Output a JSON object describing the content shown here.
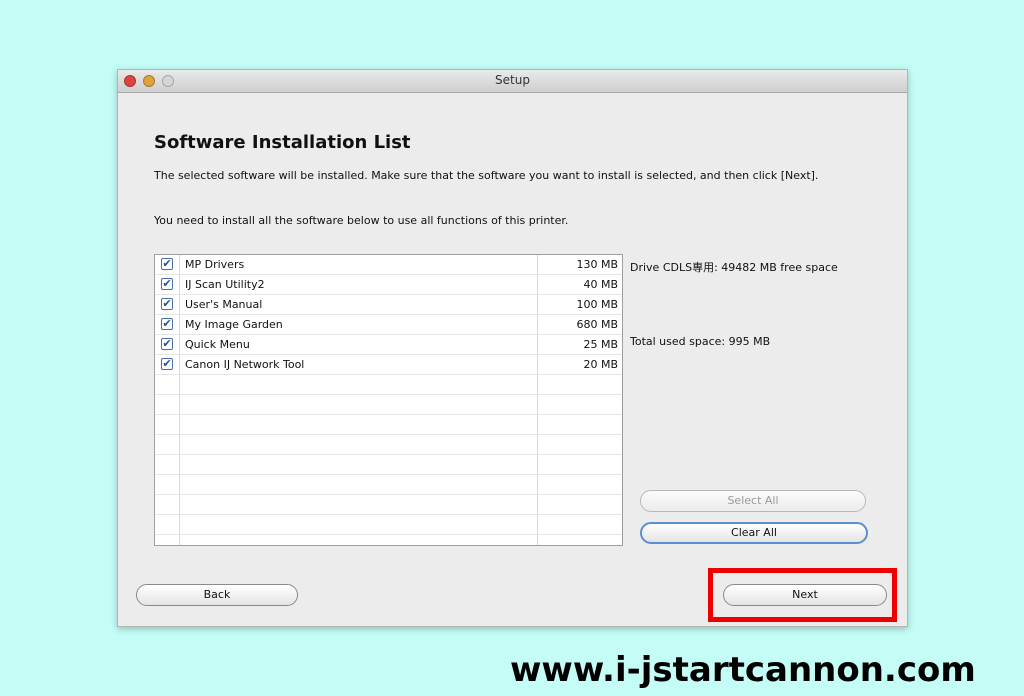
{
  "window": {
    "title": "Setup"
  },
  "page": {
    "heading": "Software Installation List",
    "description": "The selected software will be installed. Make sure that the software you want to install is selected, and then click [Next].",
    "note": "You need to install all the software below to use all functions of this printer."
  },
  "software_list": {
    "items": [
      {
        "name": "MP Drivers",
        "size": "130 MB",
        "checked": true
      },
      {
        "name": "IJ Scan Utility2",
        "size": "40 MB",
        "checked": true
      },
      {
        "name": "User's Manual",
        "size": "100 MB",
        "checked": true
      },
      {
        "name": "My Image Garden",
        "size": "680 MB",
        "checked": true
      },
      {
        "name": "Quick Menu",
        "size": "25 MB",
        "checked": true
      },
      {
        "name": "Canon IJ Network Tool",
        "size": "20 MB",
        "checked": true
      }
    ],
    "checkmark": "✔"
  },
  "info": {
    "drive": "Drive CDLS専用: 49482 MB free space",
    "total": "Total used space: 995 MB"
  },
  "buttons": {
    "select_all": "Select All",
    "clear_all": "Clear All",
    "back": "Back",
    "next": "Next"
  },
  "highlight_color": "#ee0000",
  "watermark": "www.i-jstartcannon.com"
}
